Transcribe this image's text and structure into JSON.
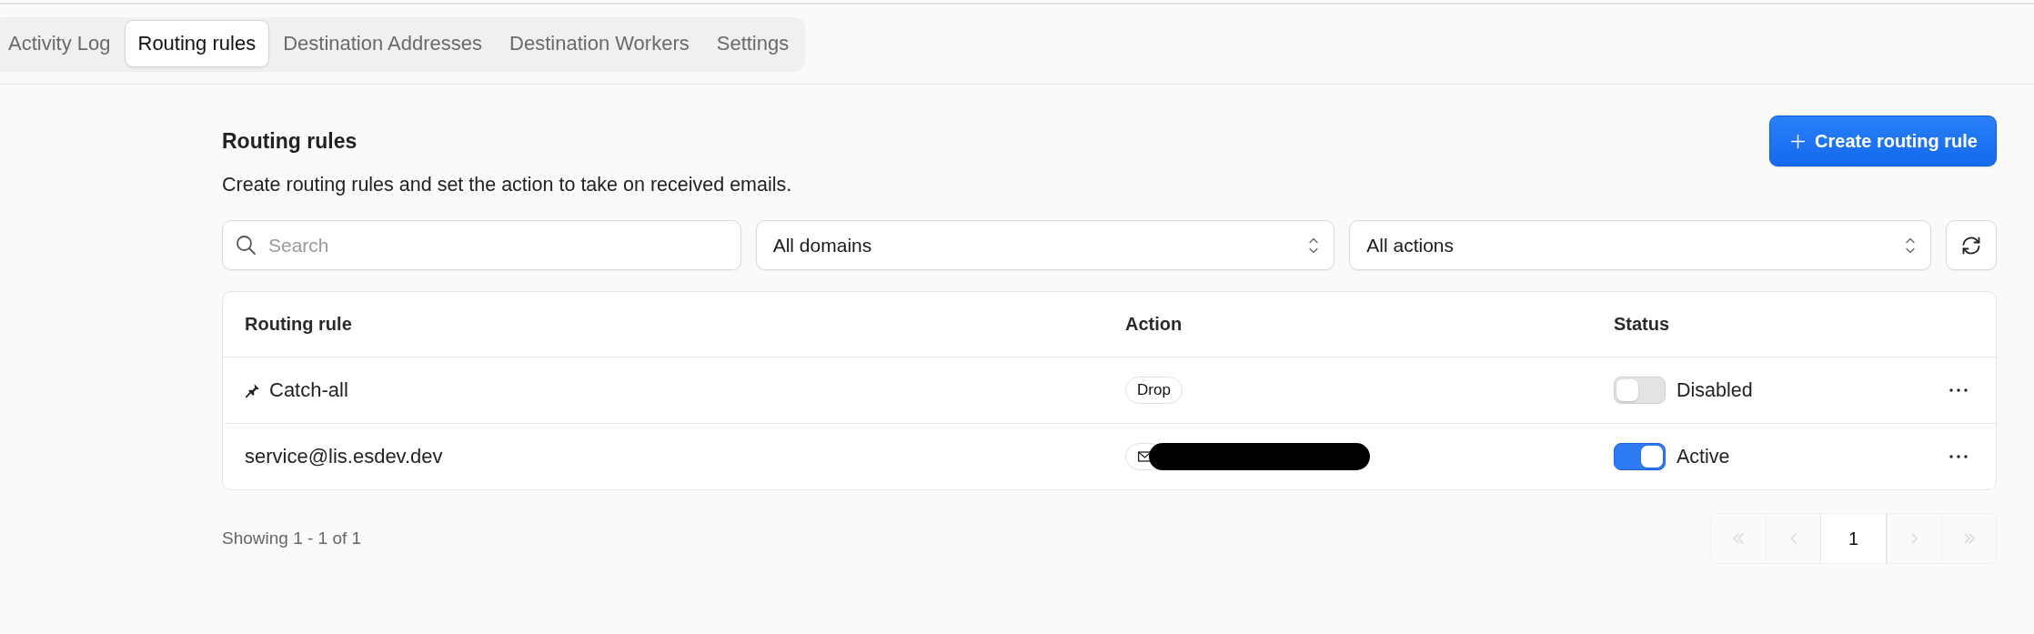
{
  "tabs": [
    {
      "label": "Activity Log",
      "selected": false
    },
    {
      "label": "Routing rules",
      "selected": true
    },
    {
      "label": "Destination Addresses",
      "selected": false
    },
    {
      "label": "Destination Workers",
      "selected": false
    },
    {
      "label": "Settings",
      "selected": false
    }
  ],
  "header": {
    "title": "Routing rules",
    "description": "Create routing rules and set the action to take on received emails.",
    "create_button": "Create routing rule"
  },
  "filters": {
    "search": {
      "placeholder": "Search"
    },
    "domain_select": {
      "value": "All domains"
    },
    "action_select": {
      "value": "All actions"
    }
  },
  "table": {
    "columns": [
      "Routing rule",
      "Action",
      "Status"
    ],
    "rows": [
      {
        "rule": "Catch-all",
        "pinned": true,
        "action": {
          "kind": "label",
          "text": "Drop"
        },
        "enabled": false,
        "status": "Disabled"
      },
      {
        "rule": "service@lis.esdev.dev",
        "pinned": false,
        "action": {
          "kind": "redacted_email"
        },
        "enabled": true,
        "status": "Active"
      }
    ]
  },
  "footer": {
    "summary": "Showing 1 - 1 of 1",
    "pagination": {
      "first_disabled": true,
      "prev_disabled": true,
      "pages": [
        {
          "label": "1",
          "selected": true
        }
      ],
      "next_disabled": true,
      "last_disabled": true
    }
  }
}
